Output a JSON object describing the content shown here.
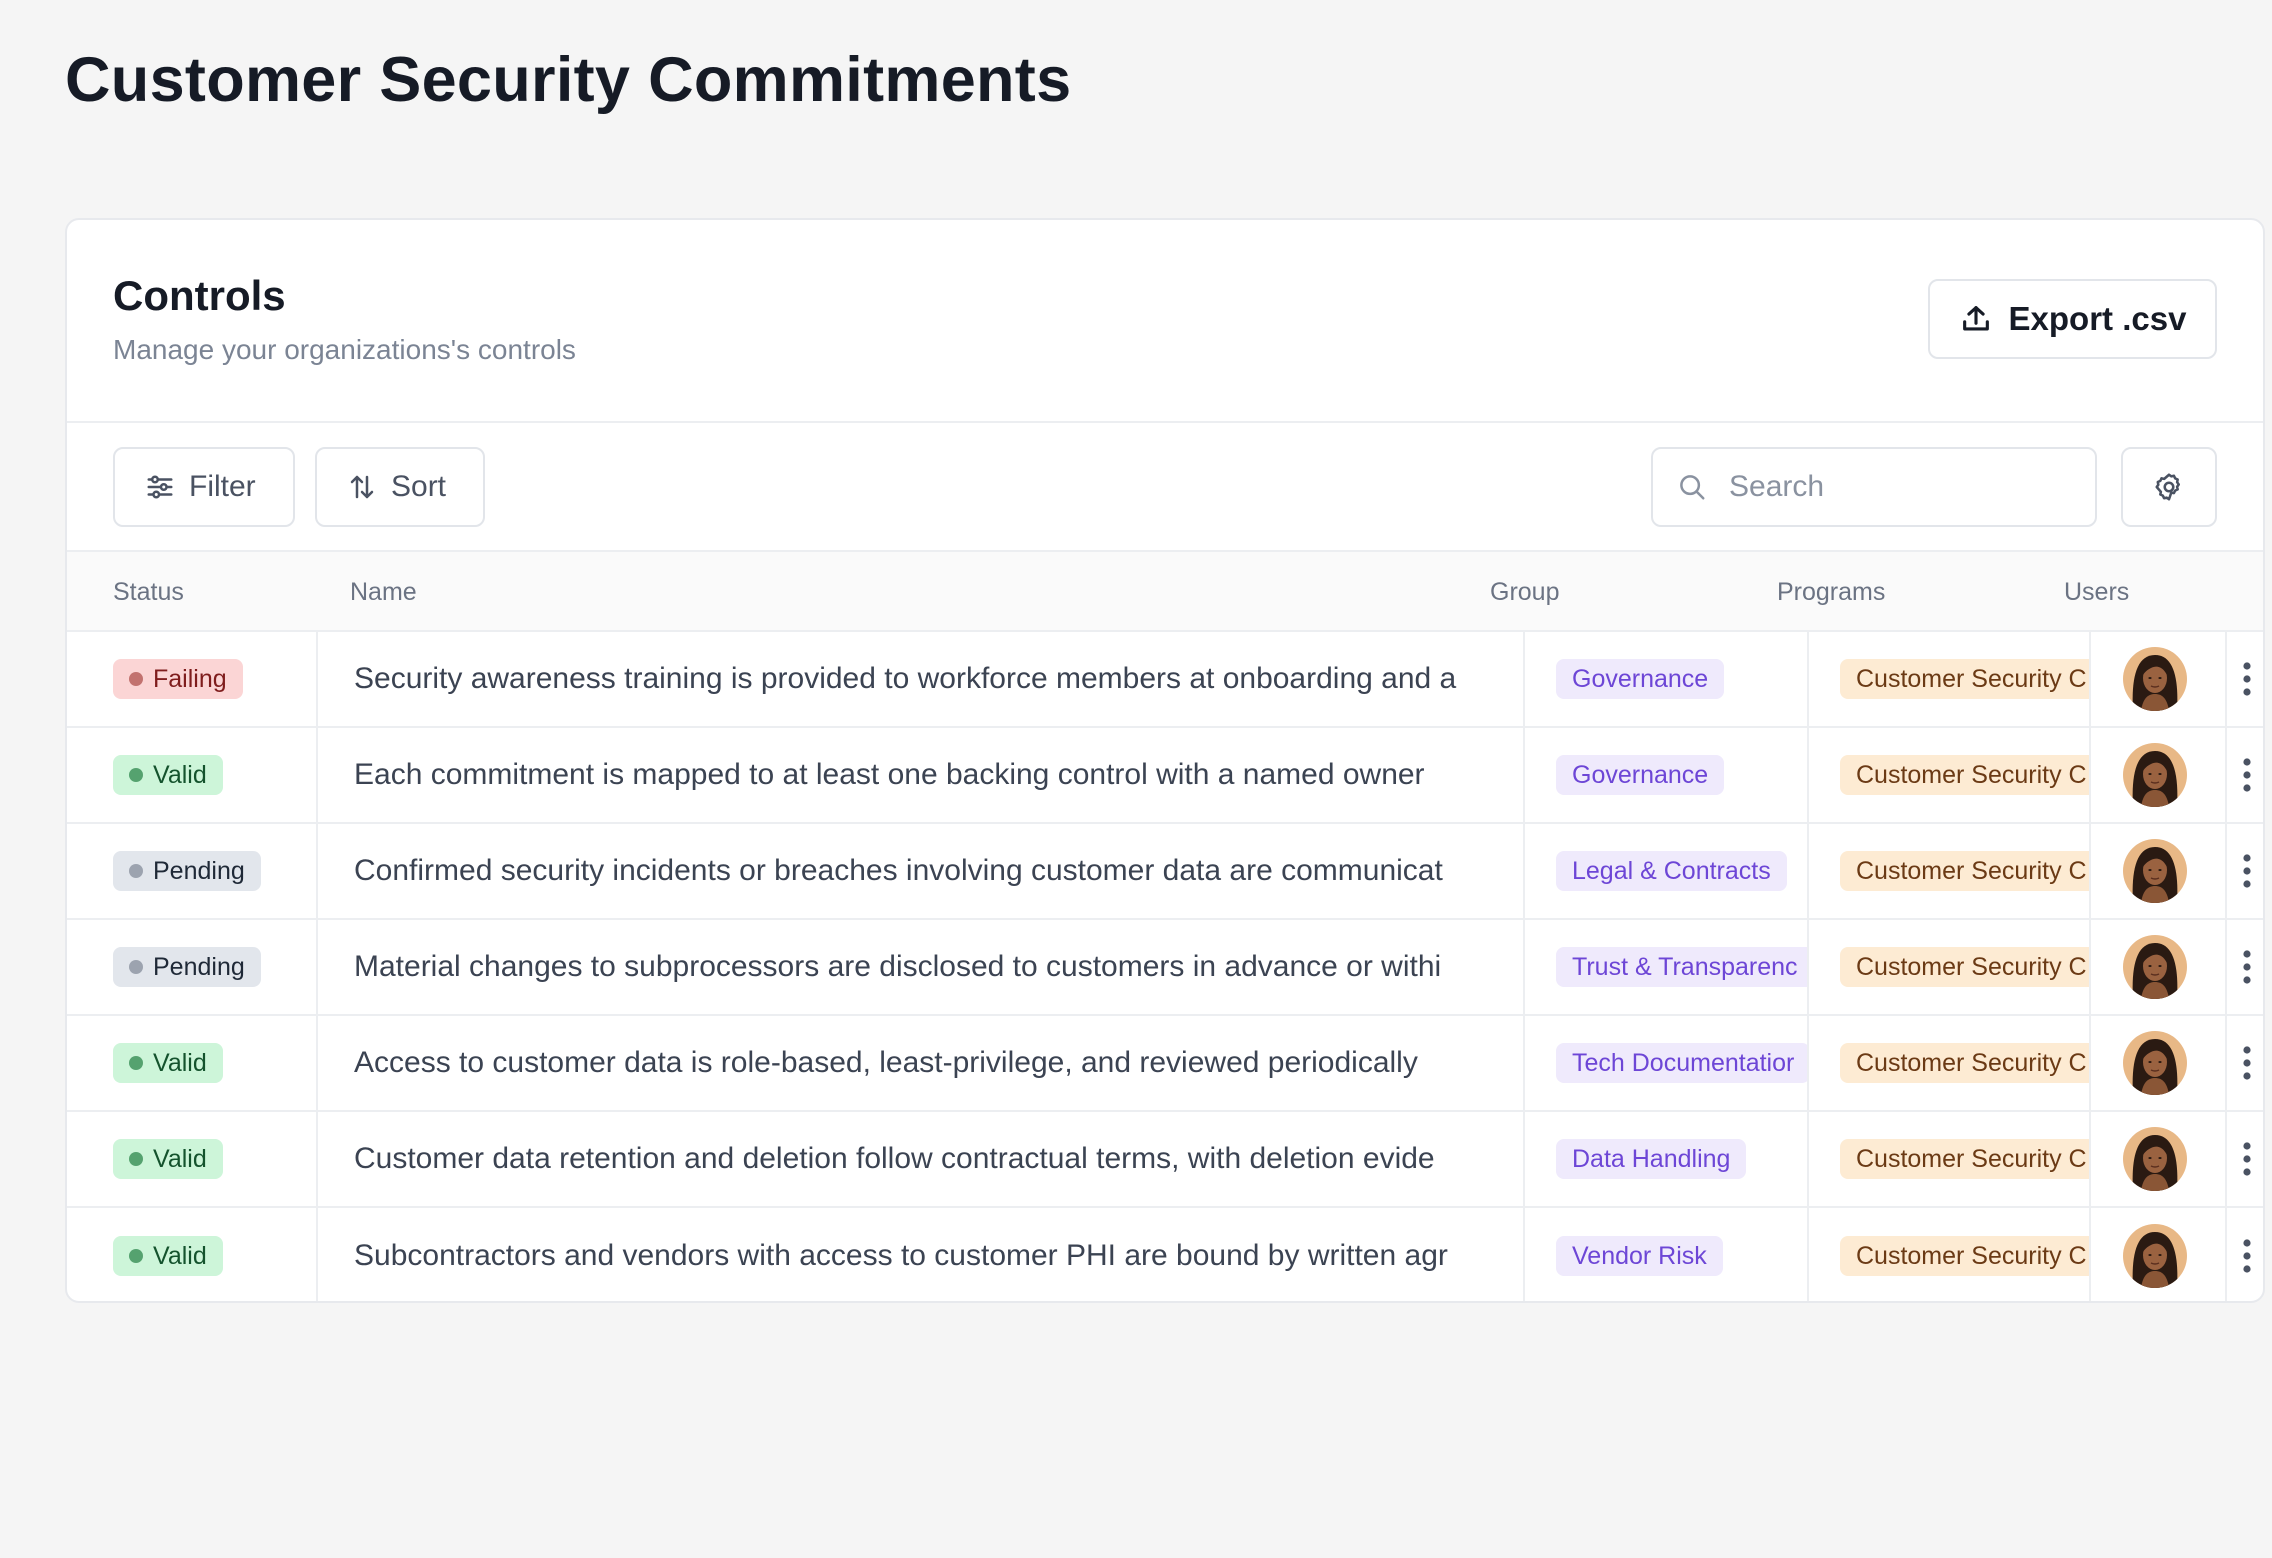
{
  "page": {
    "title": "Customer Security Commitments"
  },
  "card": {
    "title": "Controls",
    "subtitle": "Manage your organizations's controls",
    "export_label": "Export .csv"
  },
  "toolbar": {
    "filter_label": "Filter",
    "sort_label": "Sort",
    "search_placeholder": "Search",
    "icons": [
      "sliders-icon",
      "arrows-up-down-icon",
      "search-icon",
      "gear-icon"
    ]
  },
  "table": {
    "columns": [
      "Status",
      "Name",
      "Group",
      "Programs",
      "Users"
    ],
    "status_colors": {
      "Failing": {
        "bg": "#fbd5d5",
        "fg": "#7f1d1d",
        "dot": "#c2726f"
      },
      "Valid": {
        "bg": "#cdf5d9",
        "fg": "#14532d",
        "dot": "#55a26f"
      },
      "Pending": {
        "bg": "#e2e6ec",
        "fg": "#1f2937",
        "dot": "#9ca3af"
      }
    },
    "rows": [
      {
        "status": "Failing",
        "name": "Security awareness training is provided to workforce members at onboarding and a",
        "group": "Governance",
        "program": "Customer Security C"
      },
      {
        "status": "Valid",
        "name": "Each commitment is mapped to at least one backing control with a named owner",
        "group": "Governance",
        "program": "Customer Security C"
      },
      {
        "status": "Pending",
        "name": "Confirmed security incidents or breaches involving customer data are communicat",
        "group": "Legal & Contracts",
        "program": "Customer Security C"
      },
      {
        "status": "Pending",
        "name": "Material changes to subprocessors are disclosed to customers in advance or withi",
        "group": "Trust & Transparenc",
        "program": "Customer Security C"
      },
      {
        "status": "Valid",
        "name": "Access to customer data is role-based, least-privilege, and reviewed periodically",
        "group": "Tech Documentatior",
        "program": "Customer Security C"
      },
      {
        "status": "Valid",
        "name": "Customer data retention and deletion follow contractual terms, with deletion evide",
        "group": "Data Handling",
        "program": "Customer Security C"
      },
      {
        "status": "Valid",
        "name": "Subcontractors and vendors with access to customer PHI are bound by written agr",
        "group": "Vendor Risk",
        "program": "Customer Security C"
      }
    ]
  }
}
